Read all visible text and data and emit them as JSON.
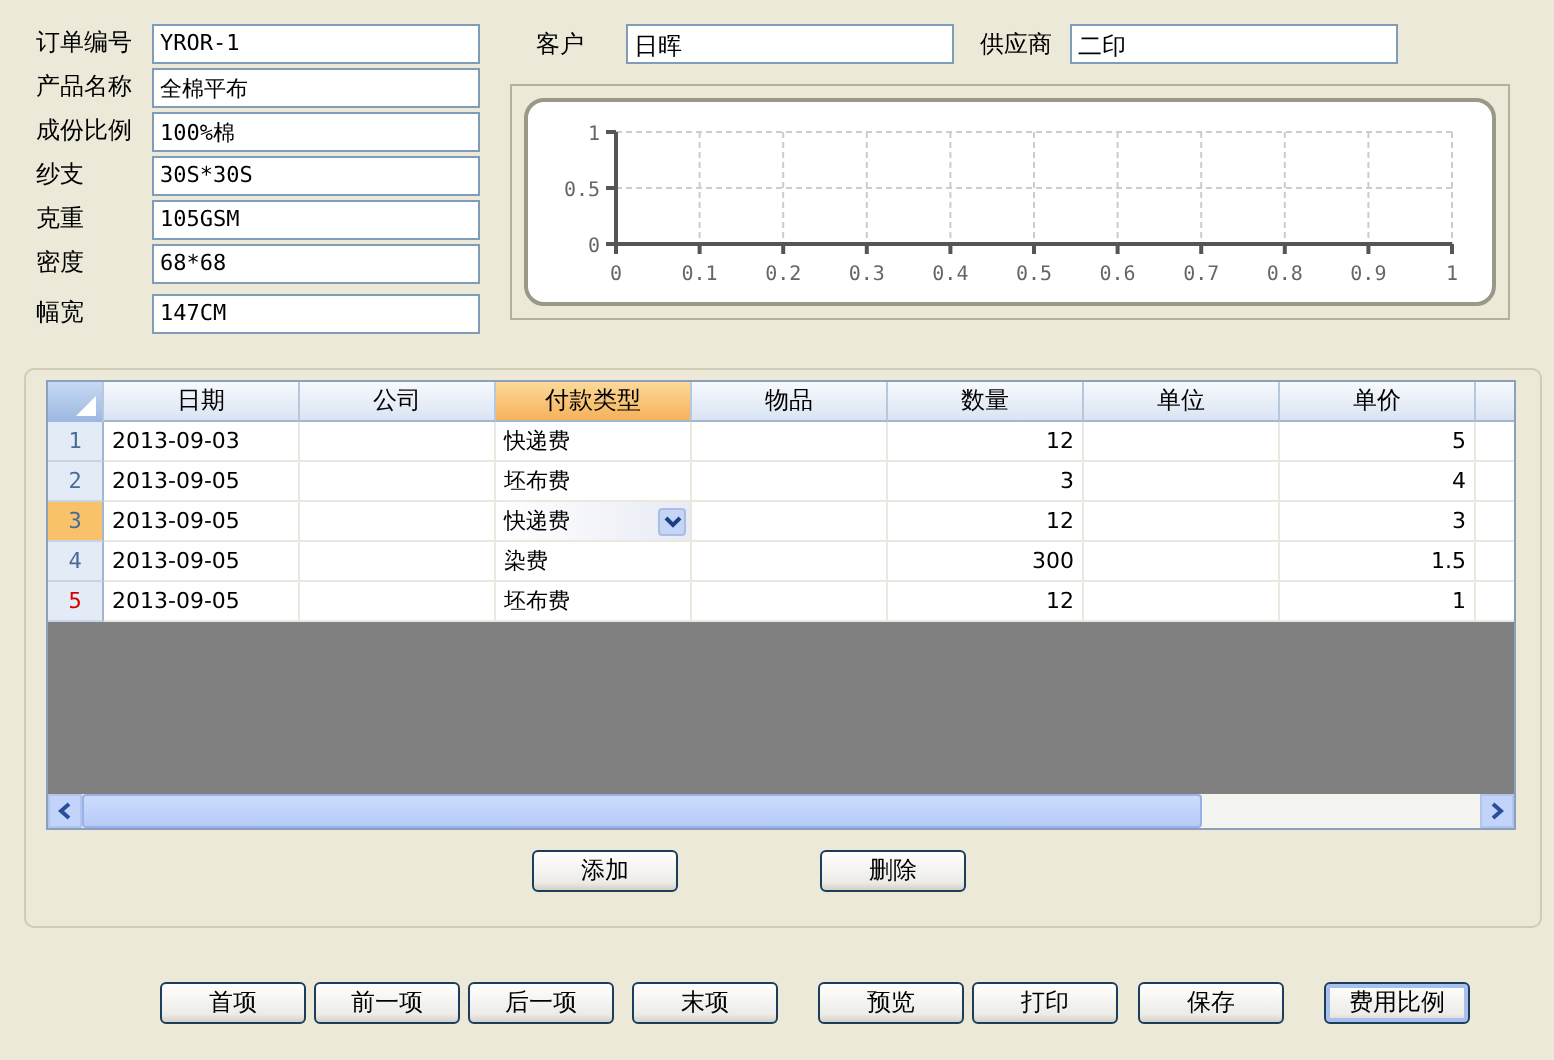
{
  "order_fields": [
    {
      "label": "订单编号",
      "value": "YROR-1"
    },
    {
      "label": "产品名称",
      "value": "全棉平布"
    },
    {
      "label": "成份比例",
      "value": "100%棉"
    },
    {
      "label": "纱支",
      "value": "30S*30S"
    },
    {
      "label": "克重",
      "value": "105GSM"
    },
    {
      "label": "密度",
      "value": "68*68"
    },
    {
      "label": "幅宽",
      "value": "147CM"
    }
  ],
  "party_fields": [
    {
      "label": "客户",
      "value": "日晖"
    },
    {
      "label": "供应商",
      "value": "二印"
    }
  ],
  "chart": {
    "chart_data": {
      "type": "line",
      "grid": true,
      "xlim": [
        0,
        1
      ],
      "ylim": [
        0,
        1
      ],
      "xticks": [
        0,
        0.1,
        0.2,
        0.3,
        0.4,
        0.5,
        0.6,
        0.7,
        0.8,
        0.9,
        1
      ],
      "yticks": [
        0,
        0.5,
        1
      ]
    }
  },
  "table": {
    "columns": [
      {
        "label": "日期",
        "selected": false
      },
      {
        "label": "公司",
        "selected": false
      },
      {
        "label": "付款类型",
        "selected": true
      },
      {
        "label": "物品",
        "selected": false
      },
      {
        "label": "数量",
        "selected": false
      },
      {
        "label": "单位",
        "selected": false
      },
      {
        "label": "单价",
        "selected": false
      }
    ],
    "rows": [
      {
        "number": "1",
        "selected": false,
        "marked": false,
        "cells": [
          "2013-09-03",
          "",
          "快递费",
          "",
          "12",
          "",
          "5"
        ]
      },
      {
        "number": "2",
        "selected": false,
        "marked": false,
        "cells": [
          "2013-09-05",
          "",
          "坯布费",
          "",
          "3",
          "",
          "4"
        ]
      },
      {
        "number": "3",
        "selected": true,
        "marked": false,
        "cells": [
          "2013-09-05",
          "",
          "快递费",
          "",
          "12",
          "",
          "3"
        ]
      },
      {
        "number": "4",
        "selected": false,
        "marked": false,
        "cells": [
          "2013-09-05",
          "",
          "染费",
          "",
          "300",
          "",
          "1.5"
        ]
      },
      {
        "number": "5",
        "selected": false,
        "marked": true,
        "cells": [
          "2013-09-05",
          "",
          "坯布费",
          "",
          "12",
          "",
          "1"
        ]
      }
    ]
  },
  "grid_buttons": [
    "添加",
    "删除"
  ],
  "buttons": [
    {
      "label": "首项",
      "focused": false
    },
    {
      "label": "前一项",
      "focused": false
    },
    {
      "label": "后一项",
      "focused": false
    },
    {
      "label": "末项",
      "focused": false
    },
    {
      "label": "预览",
      "focused": false
    },
    {
      "label": "打印",
      "focused": false
    },
    {
      "label": "保存",
      "focused": false
    },
    {
      "label": "费用比例",
      "focused": true
    }
  ]
}
